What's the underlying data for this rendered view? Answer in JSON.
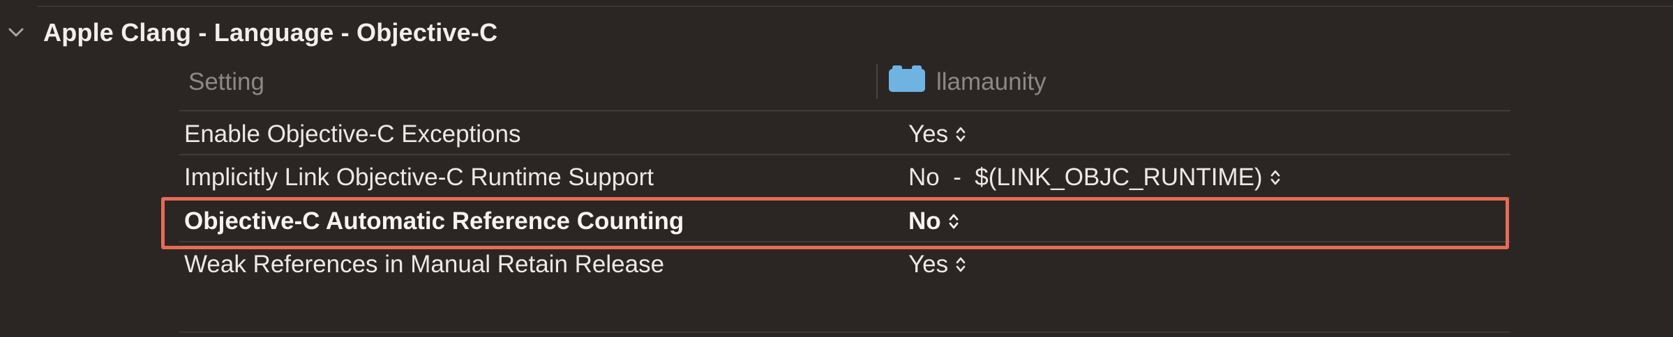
{
  "section": {
    "title": "Apple Clang - Language - Objective-C",
    "expanded": true
  },
  "columns": {
    "setting_label": "Setting",
    "target_name": "llamaunity",
    "target_icon": "app-target-icon"
  },
  "rows": [
    {
      "name": "Enable Objective-C Exceptions",
      "value": "Yes",
      "bold": false,
      "highlighted": false
    },
    {
      "name": "Implicitly Link Objective-C Runtime Support",
      "value": "No  -  $(LINK_OBJC_RUNTIME)",
      "bold": false,
      "highlighted": false
    },
    {
      "name": "Objective-C Automatic Reference Counting",
      "value": "No",
      "bold": true,
      "highlighted": true
    },
    {
      "name": "Weak References in Manual Retain Release",
      "value": "Yes",
      "bold": false,
      "highlighted": false
    }
  ],
  "colors": {
    "background": "#2b2624",
    "highlight_border": "#e66b55",
    "target_icon": "#6fb3e3"
  }
}
